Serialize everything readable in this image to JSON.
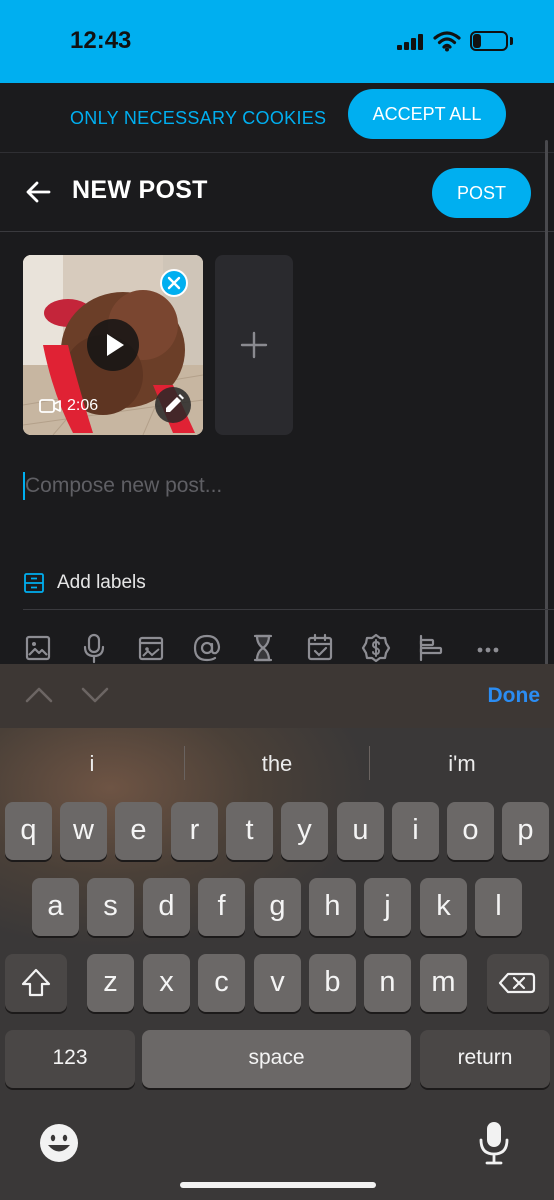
{
  "status_bar": {
    "time": "12:43",
    "battery_level": "24",
    "battery_fraction": 0.24
  },
  "cookie_bar": {
    "necessary_label": "ONLY NECESSARY COOKIES",
    "accept_label": "ACCEPT ALL"
  },
  "header": {
    "title": "NEW POST",
    "post_label": "POST"
  },
  "media": {
    "duration": "2:06"
  },
  "compose": {
    "placeholder": "Compose new post..."
  },
  "labels": {
    "add_label": "Add labels"
  },
  "toolbar": {
    "icons": [
      "image-icon",
      "microphone-icon",
      "vault-icon",
      "mention-icon",
      "hourglass-icon",
      "calendar-icon",
      "price-tag-icon",
      "poll-icon",
      "more-icon"
    ]
  },
  "keyboard": {
    "done_label": "Done",
    "suggestions": [
      "i",
      "the",
      "i'm"
    ],
    "row1": [
      "q",
      "w",
      "e",
      "r",
      "t",
      "y",
      "u",
      "i",
      "o",
      "p"
    ],
    "row2": [
      "a",
      "s",
      "d",
      "f",
      "g",
      "h",
      "j",
      "k",
      "l"
    ],
    "row3": [
      "z",
      "x",
      "c",
      "v",
      "b",
      "n",
      "m"
    ],
    "numbers_label": "123",
    "space_label": "space",
    "return_label": "return"
  }
}
